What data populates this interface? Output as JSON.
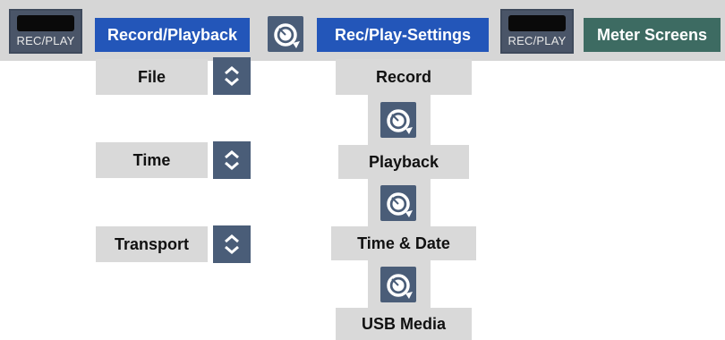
{
  "top_bar": {
    "left_device_label": "REC/PLAY",
    "record_playback_label": "Record/Playback",
    "settings_label": "Rec/Play-Settings",
    "right_device_label": "REC/PLAY",
    "meter_screens_label": "Meter Screens"
  },
  "left_menu": {
    "items": [
      {
        "label": "File"
      },
      {
        "label": "Time"
      },
      {
        "label": "Transport"
      }
    ]
  },
  "settings_menu": {
    "items": [
      {
        "label": "Record"
      },
      {
        "label": "Playback"
      },
      {
        "label": "Time & Date"
      },
      {
        "label": "USB Media"
      }
    ]
  },
  "icons": {
    "knob": "rotary-knob-icon",
    "stepper": "up-down-chevron-icon"
  },
  "colors": {
    "top_bar_bg": "#d6d6d6",
    "blue_button": "#2356b9",
    "green_button": "#3d6b62",
    "icon_button": "#4a5d78",
    "gray_item": "#d9d9d9"
  }
}
